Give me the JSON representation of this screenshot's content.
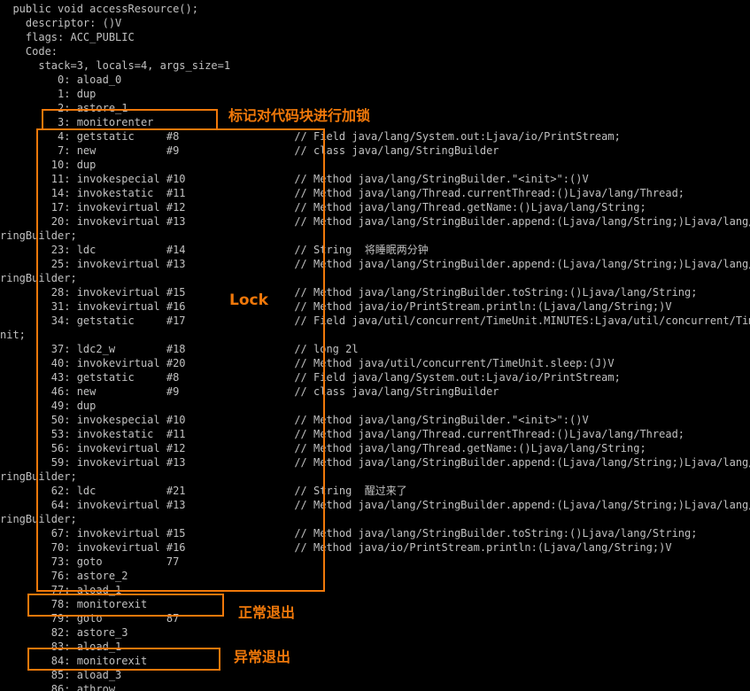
{
  "terminal": {
    "lines": [
      "  public void accessResource();",
      "    descriptor: ()V",
      "    flags: ACC_PUBLIC",
      "    Code:",
      "      stack=3, locals=4, args_size=1",
      "         0: aload_0",
      "         1: dup",
      "         2: astore_1",
      "         3: monitorenter",
      "         4: getstatic     #8                  // Field java/lang/System.out:Ljava/io/PrintStream;",
      "         7: new           #9                  // class java/lang/StringBuilder",
      "        10: dup",
      "        11: invokespecial #10                 // Method java/lang/StringBuilder.\"<init>\":()V",
      "        14: invokestatic  #11                 // Method java/lang/Thread.currentThread:()Ljava/lang/Thread;",
      "        17: invokevirtual #12                 // Method java/lang/Thread.getName:()Ljava/lang/String;",
      "        20: invokevirtual #13                 // Method java/lang/StringBuilder.append:(Ljava/lang/String;)Ljava/lang/St",
      "ringBuilder;",
      "        23: ldc           #14                 // String  将睡眠两分钟",
      "        25: invokevirtual #13                 // Method java/lang/StringBuilder.append:(Ljava/lang/String;)Ljava/lang/St",
      "ringBuilder;",
      "        28: invokevirtual #15                 // Method java/lang/StringBuilder.toString:()Ljava/lang/String;",
      "        31: invokevirtual #16                 // Method java/io/PrintStream.println:(Ljava/lang/String;)V",
      "        34: getstatic     #17                 // Field java/util/concurrent/TimeUnit.MINUTES:Ljava/util/concurrent/TimeU",
      "nit;",
      "        37: ldc2_w        #18                 // long 2l",
      "        40: invokevirtual #20                 // Method java/util/concurrent/TimeUnit.sleep:(J)V",
      "        43: getstatic     #8                  // Field java/lang/System.out:Ljava/io/PrintStream;",
      "        46: new           #9                  // class java/lang/StringBuilder",
      "        49: dup",
      "        50: invokespecial #10                 // Method java/lang/StringBuilder.\"<init>\":()V",
      "        53: invokestatic  #11                 // Method java/lang/Thread.currentThread:()Ljava/lang/Thread;",
      "        56: invokevirtual #12                 // Method java/lang/Thread.getName:()Ljava/lang/String;",
      "        59: invokevirtual #13                 // Method java/lang/StringBuilder.append:(Ljava/lang/String;)Ljava/lang/St",
      "ringBuilder;",
      "        62: ldc           #21                 // String  醒过来了",
      "        64: invokevirtual #13                 // Method java/lang/StringBuilder.append:(Ljava/lang/String;)Ljava/lang/St",
      "ringBuilder;",
      "        67: invokevirtual #15                 // Method java/lang/StringBuilder.toString:()Ljava/lang/String;",
      "        70: invokevirtual #16                 // Method java/io/PrintStream.println:(Ljava/lang/String;)V",
      "        73: goto          77",
      "        76: astore_2",
      "        77: aload_1",
      "        78: monitorexit",
      "        79: goto          87",
      "        82: astore_3",
      "        83: aload_1",
      "        84: monitorexit",
      "        85: aload_3",
      "        86: athrow"
    ]
  },
  "annotations": {
    "monitorenter_label": "标记对代码块进行加锁",
    "lock_label": "Lock",
    "normal_exit_label": "正常退出",
    "exception_exit_label": "异常退出",
    "accent_color": "#f0780a"
  }
}
